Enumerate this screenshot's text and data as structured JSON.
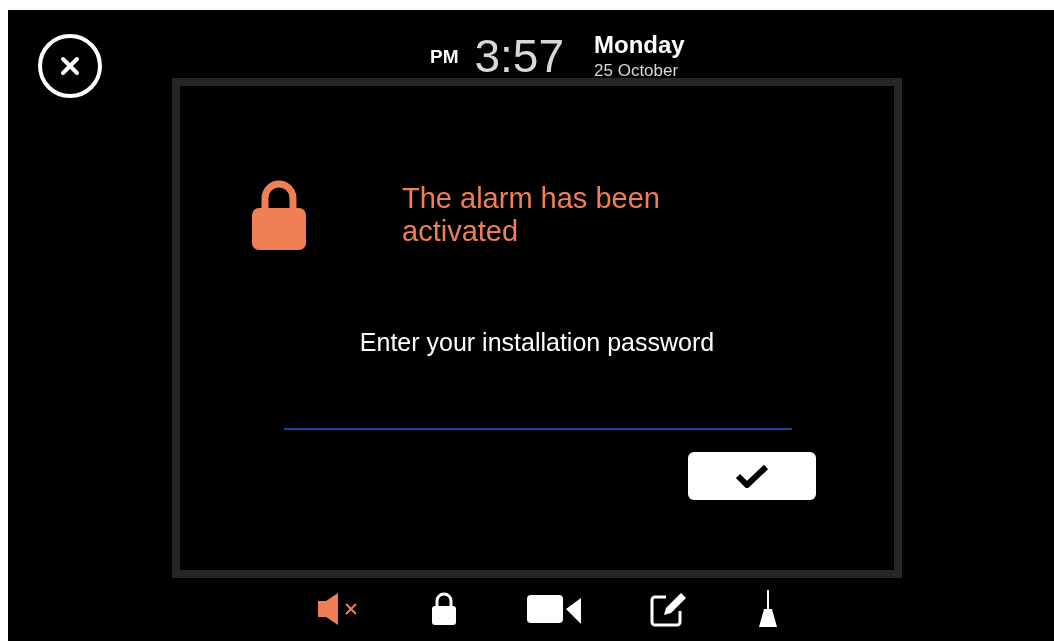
{
  "clock": {
    "period": "PM",
    "time": "3:57",
    "day": "Monday",
    "date": "25 October"
  },
  "dialog": {
    "title": "The alarm has been activated",
    "prompt": "Enter your installation password"
  },
  "toolbar": [
    {
      "kind": "mute",
      "highlighted": true
    },
    {
      "kind": "lock",
      "highlighted": false
    },
    {
      "kind": "camera",
      "highlighted": false
    },
    {
      "kind": "edit",
      "highlighted": false
    },
    {
      "kind": "broom",
      "highlighted": false
    }
  ]
}
